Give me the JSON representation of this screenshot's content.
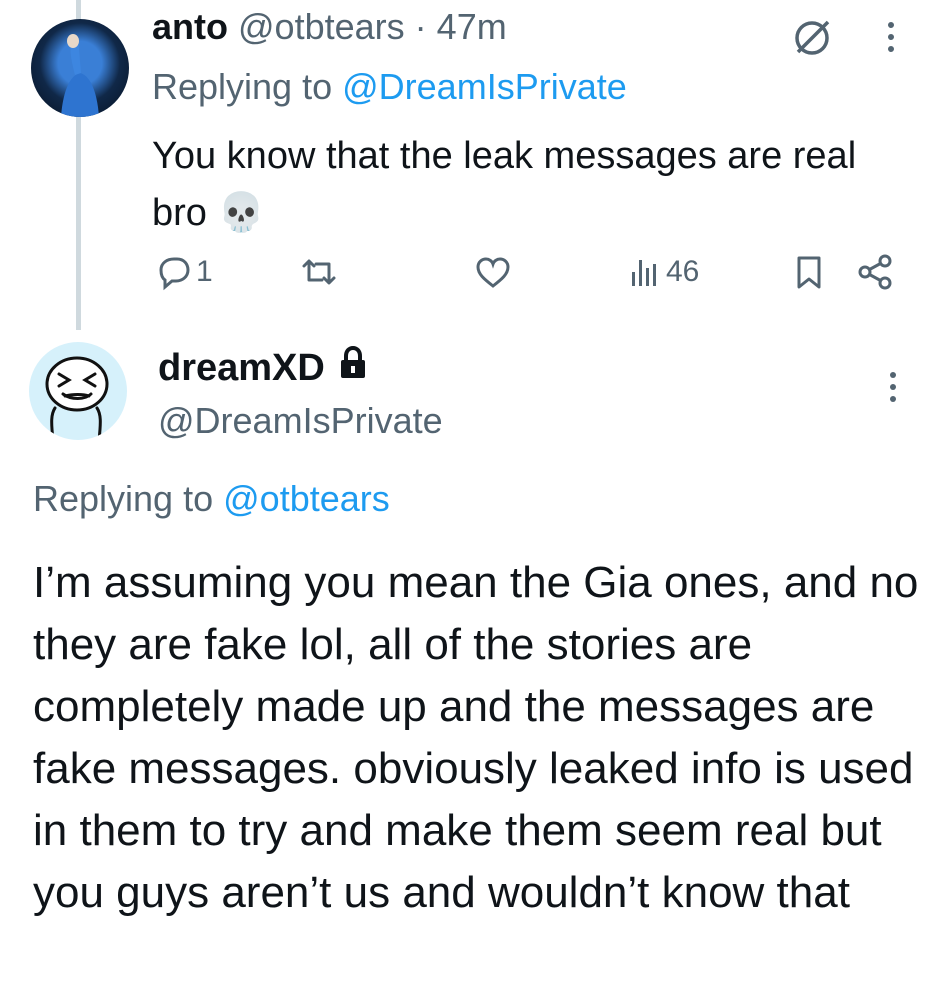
{
  "tweet1": {
    "name": "anto",
    "handle": "@otbtears",
    "separator": "·",
    "time": "47m",
    "replying_prefix": "Replying to",
    "replying_handle": "@DreamIsPrivate",
    "text": "You know that the leak messages are real bro 💀",
    "reply_count": "1",
    "views": "46"
  },
  "tweet2": {
    "name": "dreamXD",
    "handle": "@DreamIsPrivate",
    "replying_prefix": "Replying to",
    "replying_handle": "@otbtears",
    "text": "I’m assuming you mean the Gia ones, and no they are fake lol, all of the stories are completely made up and the messages are fake messages. obviously leaked info is used in them to try and make them seem real but you guys aren’t us and wouldn’t know that"
  },
  "colors": {
    "link": "#1d9bf0",
    "secondary_text": "#536471",
    "thread_line": "#cfd9de"
  },
  "icons": [
    "no-sign-icon",
    "more-icon",
    "reply-icon",
    "retweet-icon",
    "like-icon",
    "views-icon",
    "bookmark-icon",
    "share-icon",
    "lock-icon",
    "skull-emoji"
  ]
}
